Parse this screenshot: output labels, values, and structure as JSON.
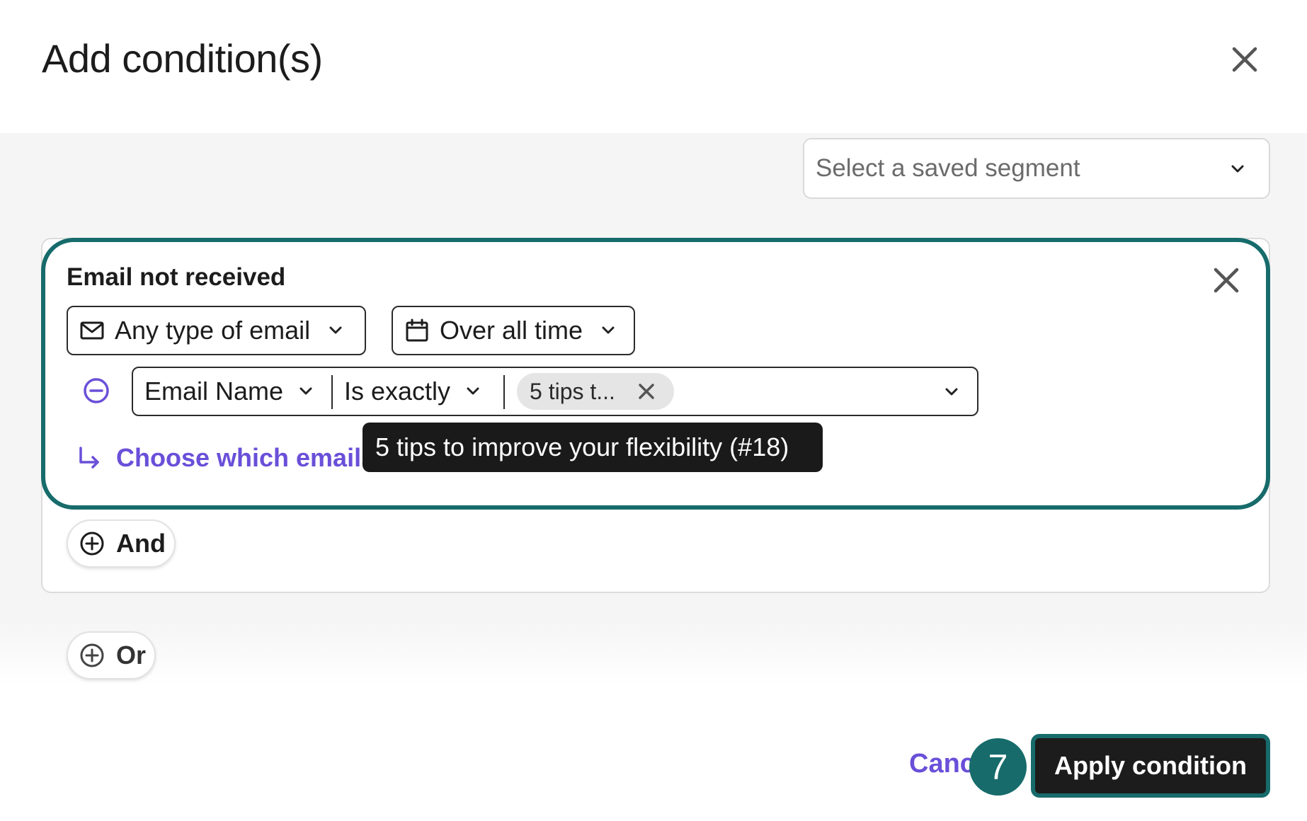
{
  "dialog": {
    "title": "Add condition(s)",
    "close_icon": "close-icon"
  },
  "segment": {
    "placeholder": "Select a saved segment",
    "icon": "chevron-down-icon"
  },
  "condition": {
    "title": "Email not received",
    "email_type": {
      "label": "Any type of email",
      "icon": "envelope-icon"
    },
    "time_range": {
      "label": "Over all time",
      "icon": "calendar-icon"
    },
    "filter": {
      "field": "Email Name",
      "operator": "Is exactly",
      "chip_value": "5 tips t...",
      "remove_icon": "minus-circle-icon"
    },
    "choose_link": "Choose which emails",
    "tooltip": "5 tips to improve your flexibility (#18)"
  },
  "buttons": {
    "and_label": "And",
    "or_label": "Or"
  },
  "footer": {
    "cancel_label": "Canc",
    "step_number": "7",
    "apply_label": "Apply condition"
  },
  "colors": {
    "accent_teal": "#176b6b",
    "link_purple": "#6a4fd9",
    "dark": "#1c1c1c"
  }
}
